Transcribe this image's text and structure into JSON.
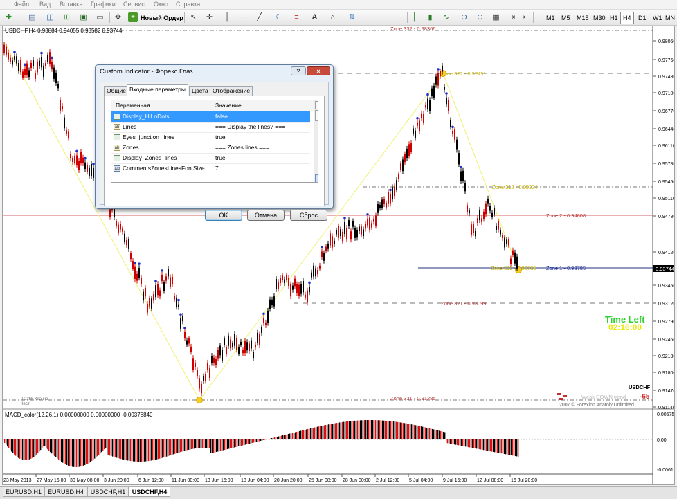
{
  "menu": [
    "Файл",
    "Вид",
    "Вставка",
    "Графики",
    "Сервис",
    "Окно",
    "Справка"
  ],
  "toolbar": {
    "new_order_label": "Новый Ордер",
    "timeframes": [
      "M1",
      "M5",
      "M15",
      "M30",
      "H1",
      "H4",
      "D1",
      "W1",
      "MN"
    ],
    "active_timeframe": "H4"
  },
  "chart": {
    "title": "USDCHF,H4  0.93884 0.94055 0.93582 0.93744",
    "price_axis": [
      "0.98060",
      "0.97760",
      "0.97430",
      "0.97100",
      "0.96770",
      "0.96440",
      "0.96110",
      "0.95780",
      "0.95450",
      "0.95110",
      "0.94780",
      "0.94120",
      "0.93790",
      "0.93450",
      "0.93120",
      "0.92790",
      "0.92460",
      "0.92130",
      "0.91800",
      "0.91470",
      "0.91140"
    ],
    "current_price": "0.93744",
    "time_axis": [
      "23 May 2013",
      "27 May 16:00",
      "30 May 08:00",
      "3 Jun 20:00",
      "6 Jun 12:00",
      "11 Jun 00:00",
      "13 Jun 16:00",
      "18 Jun 04:00",
      "20 Jun 20:00",
      "25 Jun 08:00",
      "28 Jun 00:00",
      "2 Jul 12:00",
      "5 Jul 04:00",
      "9 Jul 16:00",
      "12 Jul 08:00",
      "16 Jul 20:00"
    ],
    "zones": [
      {
        "label": "Zone 332 - 0.98366",
        "color": "#b03a3a"
      },
      {
        "label": "Zone 322 - 0.97491",
        "color": "#c8b400"
      },
      {
        "label": "Zone 312 - 0.95324",
        "color": "#c8b400"
      },
      {
        "label": "Zone 2 - 0.94808",
        "color": "#c03030"
      },
      {
        "label": "Zone 312 - 0.93785",
        "color": "#c8b400"
      },
      {
        "label": "Zone 1 - 0.93785",
        "color": "#2030a0"
      },
      {
        "label": "Zone 321 - 0.93099",
        "color": "#b03a3a"
      },
      {
        "label": "Zone 331 - 0.91285",
        "color": "#b03a3a"
      }
    ],
    "time_left_label": "Time Left",
    "time_left_value": "02:16:00",
    "symbol_badge": "USDCHF",
    "trend_text": "Weak DOWN trend",
    "trend_value": "-65",
    "copyright": "2007 © Forexinn Anatoly Unlimited",
    "tiny_label": "0.2366 Кеэнчэ",
    "tiny_label2": "Кест",
    "macd_title": "MACD_color(12,26,1) 0.00000000 0.00000000 -0.00378840",
    "macd_axis": [
      "0.005759",
      "0.00",
      "-0.006119"
    ]
  },
  "tabs": [
    "EURUSD,H1",
    "EURUSD,H4",
    "USDCHF,H1",
    "USDCHF,H4"
  ],
  "active_tab": "USDCHF,H4",
  "dialog": {
    "title": "Custom Indicator - Форекс Глаз",
    "help": "?",
    "close": "×",
    "tabs": [
      "Общие",
      "Входные параметры",
      "Цвета",
      "Отображение"
    ],
    "active_tab": "Входные параметры",
    "col_name": "Переменная",
    "col_value": "Значение",
    "rows": [
      {
        "name": "Display_HiLoDots",
        "value": "false",
        "icon": "chart"
      },
      {
        "name": "Lines",
        "value": "=== Display the lines? ===",
        "icon": "ab"
      },
      {
        "name": "Eyes_junction_lines",
        "value": "true",
        "icon": "chart"
      },
      {
        "name": "Zones",
        "value": "=== Zones lines ===",
        "icon": "ab"
      },
      {
        "name": "Display_Zones_lines",
        "value": "true",
        "icon": "chart"
      },
      {
        "name": "CommentsZonesLinesFontSize",
        "value": "7",
        "icon": "123"
      }
    ],
    "ok": "OK",
    "cancel": "Отмена",
    "reset": "Сброс"
  }
}
